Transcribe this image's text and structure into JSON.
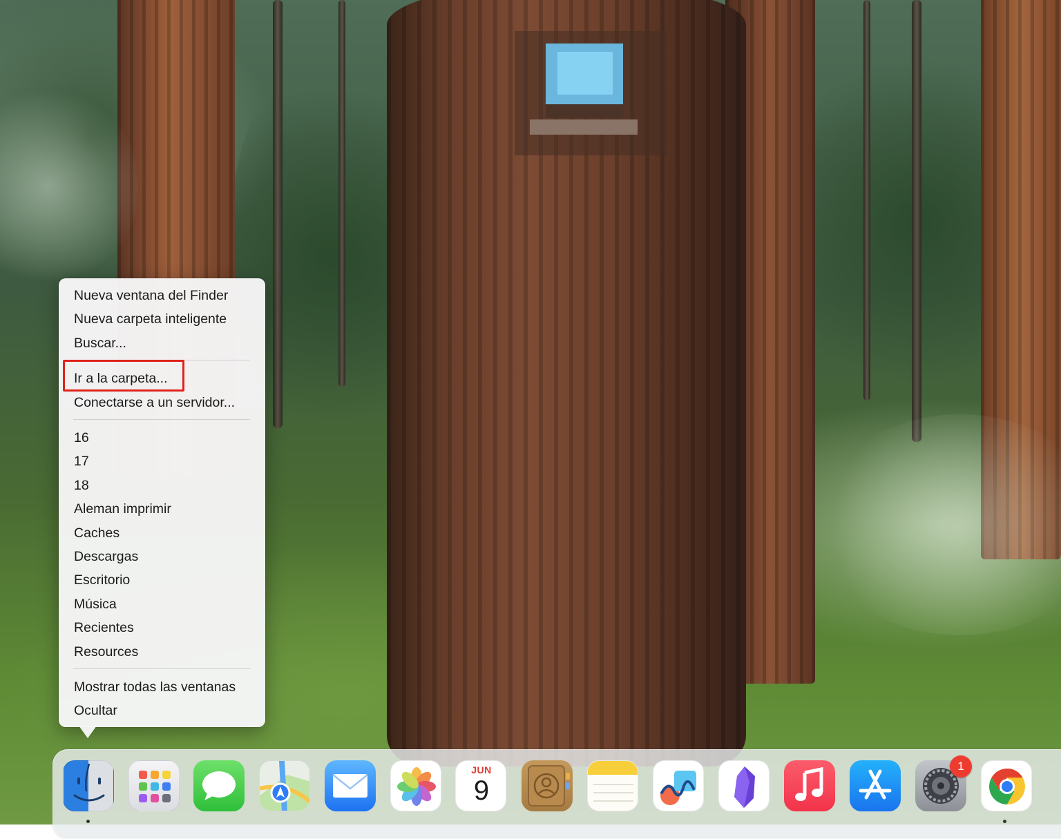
{
  "context_menu": {
    "new_finder_window": "Nueva ventana del Finder",
    "new_smart_folder": "Nueva carpeta inteligente",
    "search": "Buscar...",
    "go_to_folder": "Ir a la carpeta...",
    "connect_server": "Conectarse a un servidor...",
    "recent_folders": [
      "16",
      "17",
      "18",
      "Aleman imprimir",
      "Caches",
      "Descargas",
      "Escritorio",
      "Música",
      "Recientes",
      "Resources"
    ],
    "show_all_windows": "Mostrar todas las ventanas",
    "hide": "Ocultar",
    "highlighted_item": "go_to_folder"
  },
  "dock": {
    "apps": [
      "finder",
      "launchpad",
      "messages",
      "maps",
      "mail",
      "photos",
      "calendar",
      "contacts",
      "notes",
      "freeform",
      "obsidian",
      "music",
      "app-store",
      "system-settings",
      "chrome"
    ],
    "calendar_month": "JUN",
    "calendar_day": "9",
    "settings_badge": "1",
    "running_apps": [
      "finder",
      "chrome"
    ]
  },
  "colors": {
    "highlight_border": "#e0231b",
    "badge": "#ee3b30"
  }
}
